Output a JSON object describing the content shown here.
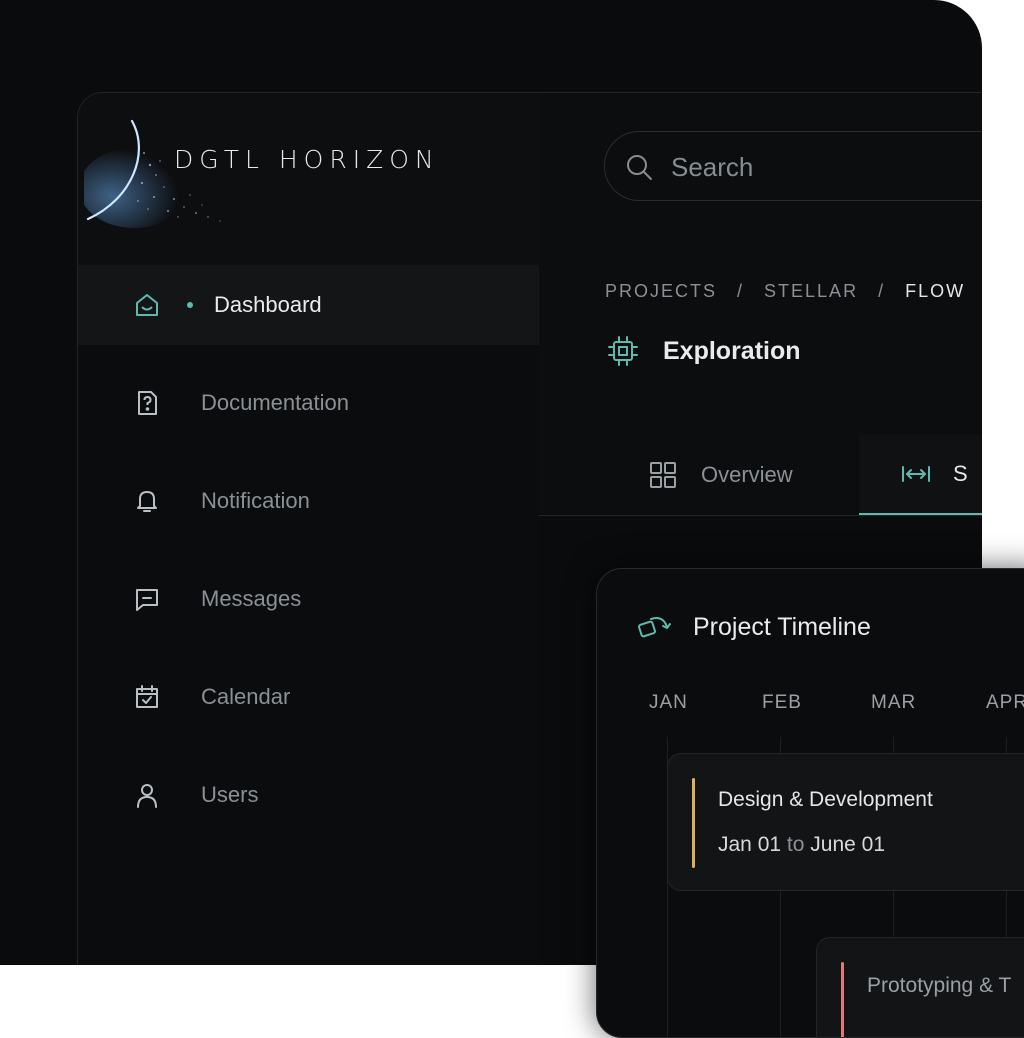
{
  "brand": {
    "name": "DGTL HORIZON"
  },
  "sidebar": {
    "items": [
      {
        "label": "Dashboard",
        "icon": "home-icon",
        "active": true
      },
      {
        "label": "Documentation",
        "icon": "help-document-icon"
      },
      {
        "label": "Notification",
        "icon": "bell-icon"
      },
      {
        "label": "Messages",
        "icon": "message-icon"
      },
      {
        "label": "Calendar",
        "icon": "calendar-icon"
      },
      {
        "label": "Users",
        "icon": "user-icon"
      }
    ]
  },
  "search": {
    "placeholder": "Search"
  },
  "breadcrumb": {
    "items": [
      "PROJECTS",
      "STELLAR",
      "FLOW"
    ],
    "separator": "/"
  },
  "page": {
    "title": "Exploration"
  },
  "tabs": [
    {
      "label": "Overview",
      "icon": "grid-icon"
    },
    {
      "label": "S",
      "icon": "expand-width-icon",
      "active": true
    }
  ],
  "timeline": {
    "title": "Project Timeline",
    "months": [
      "JAN",
      "FEB",
      "MAR",
      "APR"
    ],
    "tasks": [
      {
        "name": "Design & Development",
        "start": "Jan 01",
        "to": "to",
        "end": "June 01",
        "color": "#e0b15c"
      },
      {
        "name": "Prototyping & T",
        "color": "#e07a7a"
      }
    ]
  },
  "colors": {
    "accent": "#5fb9ad",
    "background": "#0a0b0c"
  }
}
